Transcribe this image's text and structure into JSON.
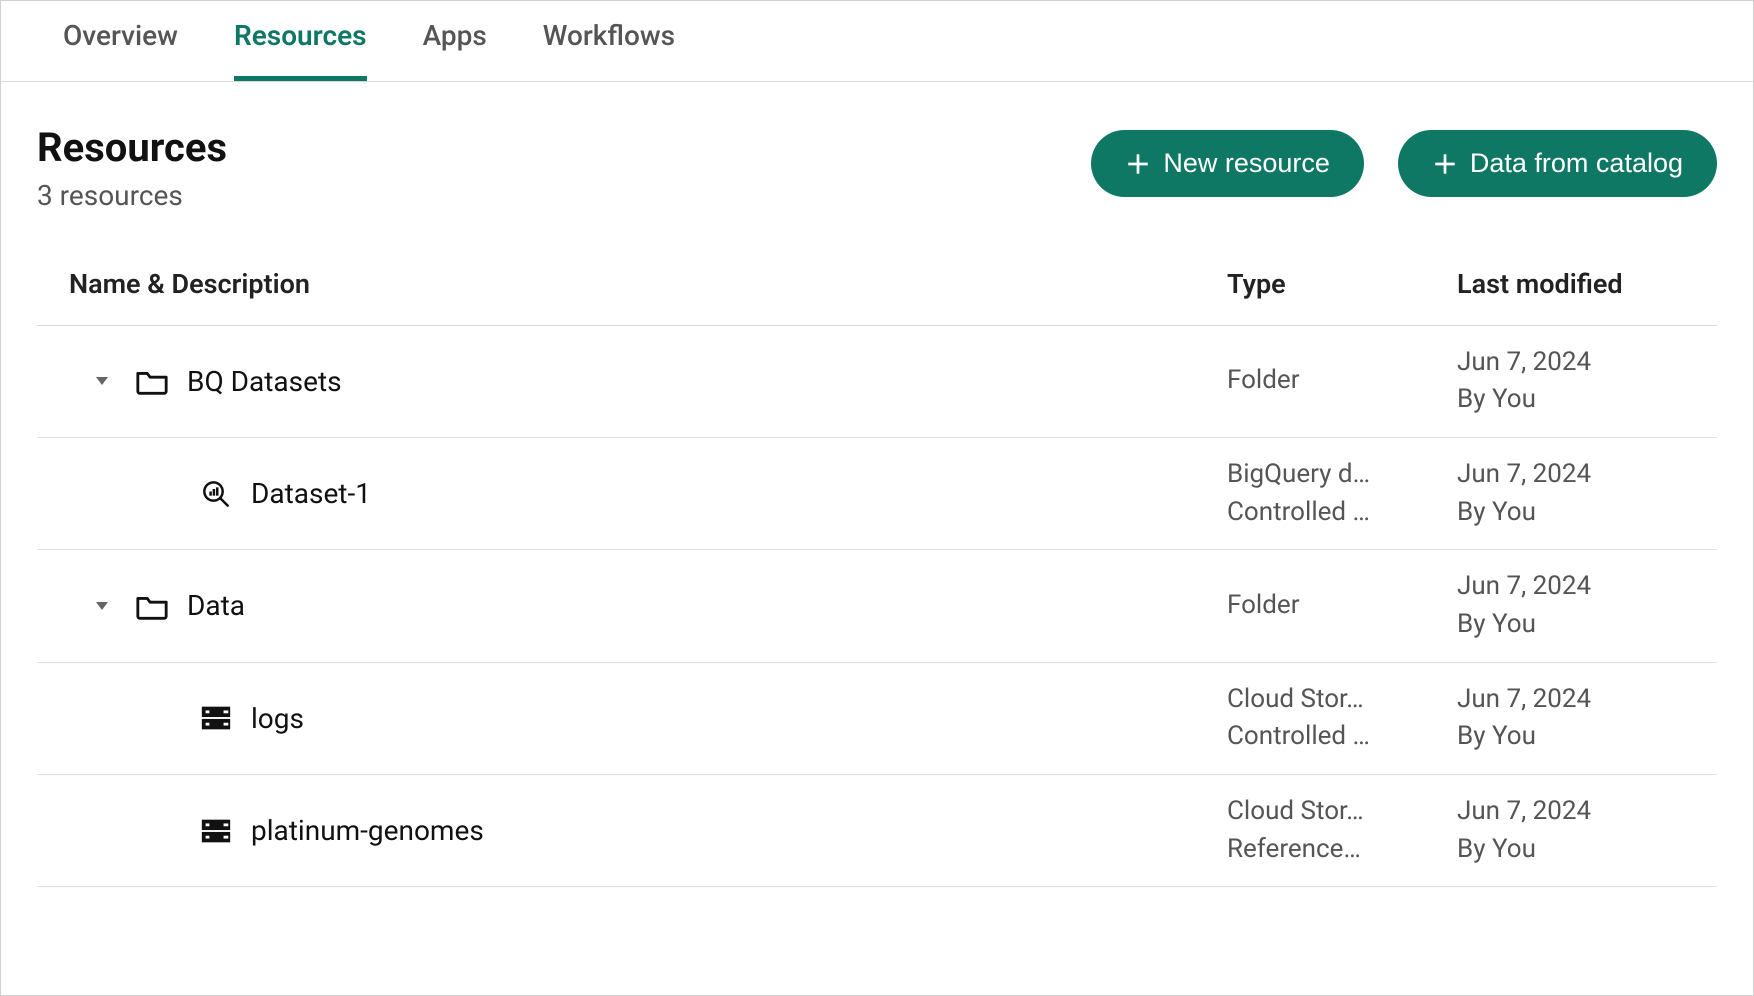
{
  "tabs": {
    "overview": "Overview",
    "resources": "Resources",
    "apps": "Apps",
    "workflows": "Workflows"
  },
  "header": {
    "title": "Resources",
    "subtitle": "3 resources",
    "new_resource_label": "New resource",
    "catalog_label": "Data from catalog"
  },
  "columns": {
    "name": "Name & Description",
    "type": "Type",
    "modified": "Last modified"
  },
  "rows": [
    {
      "name": "BQ Datasets",
      "type_line1": "Folder",
      "type_line2": "",
      "mod_line1": "Jun 7, 2024",
      "mod_line2": "By You",
      "level": 0,
      "icon": "folder",
      "expandable": true
    },
    {
      "name": "Dataset-1",
      "type_line1": "BigQuery d…",
      "type_line2": "Controlled …",
      "mod_line1": "Jun 7, 2024",
      "mod_line2": "By You",
      "level": 1,
      "icon": "bq",
      "expandable": false
    },
    {
      "name": "Data",
      "type_line1": "Folder",
      "type_line2": "",
      "mod_line1": "Jun 7, 2024",
      "mod_line2": "By You",
      "level": 0,
      "icon": "folder",
      "expandable": true
    },
    {
      "name": "logs",
      "type_line1": "Cloud Stor…",
      "type_line2": "Controlled …",
      "mod_line1": "Jun 7, 2024",
      "mod_line2": "By You",
      "level": 1,
      "icon": "storage",
      "expandable": false
    },
    {
      "name": "platinum-genomes",
      "type_line1": "Cloud Stor…",
      "type_line2": "Reference…",
      "mod_line1": "Jun 7, 2024",
      "mod_line2": "By You",
      "level": 1,
      "icon": "storage",
      "expandable": false
    }
  ]
}
